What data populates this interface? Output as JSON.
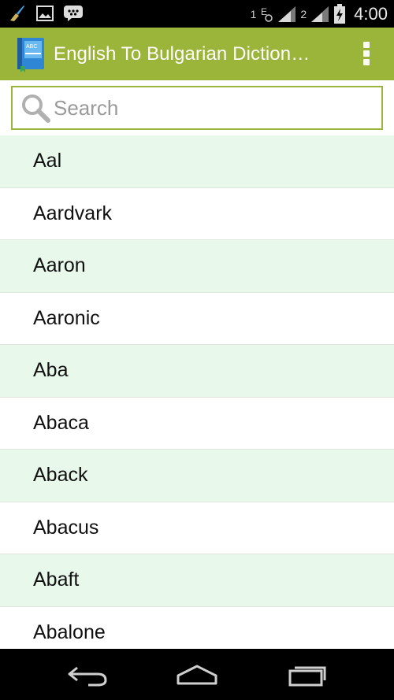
{
  "status_bar": {
    "time": "4:00",
    "sim1_label": "1",
    "sim2_label": "2",
    "icons": [
      "broom-icon",
      "image-icon",
      "bbm-icon",
      "data-icon",
      "signal-icon",
      "signal-icon",
      "battery-icon"
    ]
  },
  "app_bar": {
    "title": "English To Bulgarian Diction…",
    "icon": "book-icon",
    "menu_icon": "overflow-menu-icon"
  },
  "search": {
    "placeholder": "Search",
    "value": ""
  },
  "words": [
    "Aal",
    "Aardvark",
    "Aaron",
    "Aaronic",
    "Aba",
    "Abaca",
    "Aback",
    "Abacus",
    "Abaft",
    "Abalone"
  ],
  "colors": {
    "accent": "#9bb43a",
    "row_alt": "#e8f8ea",
    "row": "#ffffff"
  },
  "nav_bar": {
    "icons": [
      "back-icon",
      "home-icon",
      "recent-apps-icon"
    ]
  }
}
